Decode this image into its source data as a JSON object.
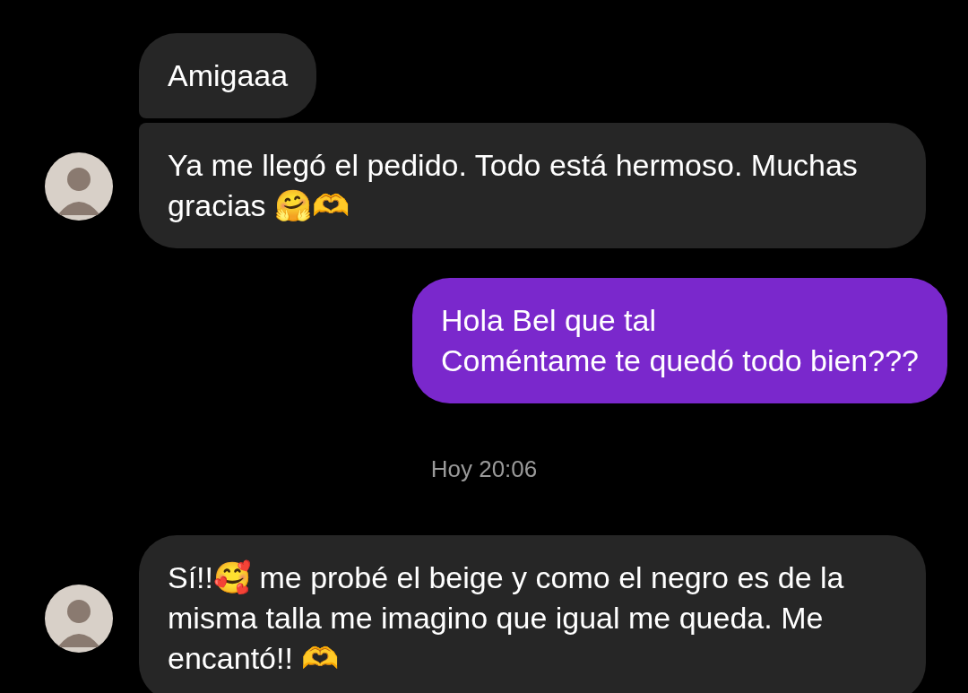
{
  "messages": [
    {
      "kind": "received",
      "avatar": false,
      "text": "Amigaaa"
    },
    {
      "kind": "received",
      "avatar": true,
      "text": "Ya me llegó el pedido. Todo está hermoso. Muchas gracias 🤗🫶"
    },
    {
      "kind": "sent",
      "text": "Hola Bel que tal\nComéntame te quedó todo bien???"
    },
    {
      "kind": "timestamp",
      "text": "Hoy 20:06"
    },
    {
      "kind": "received",
      "avatar": true,
      "text": "Sí!!🥰 me probé el beige y como el negro es de la misma talla me imagino que igual me queda. Me encantó!! 🫶"
    }
  ]
}
